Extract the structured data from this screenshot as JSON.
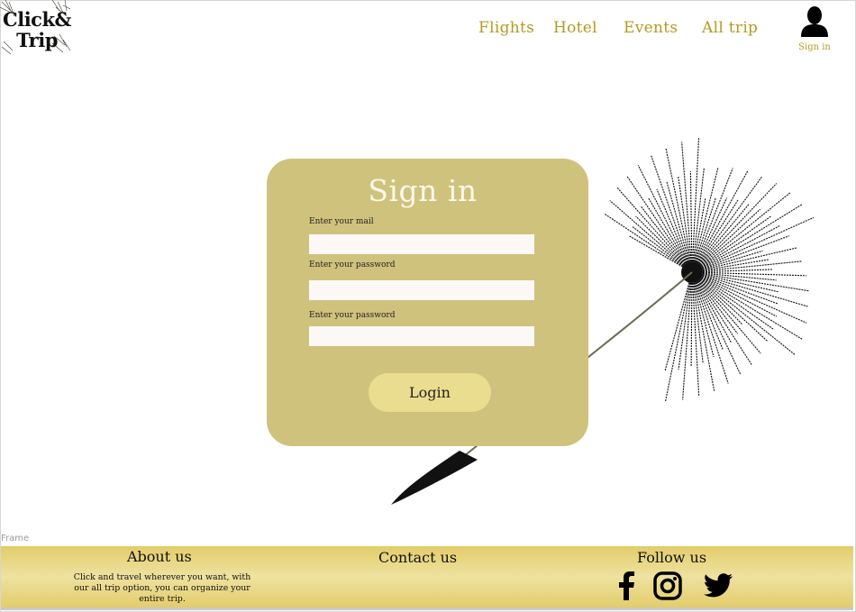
{
  "logo": {
    "text": "Click&\nTrip"
  },
  "nav": {
    "items": [
      {
        "label": "Flights"
      },
      {
        "label": "Hotel"
      },
      {
        "label": "Events"
      },
      {
        "label": "All trip"
      }
    ],
    "user_label": "Sign in"
  },
  "login": {
    "title": "Sign in",
    "fields": [
      {
        "label": "Enter your mail",
        "value": ""
      },
      {
        "label": "Enter your password",
        "value": ""
      },
      {
        "label": "Enter your password",
        "value": ""
      }
    ],
    "button_label": "Login"
  },
  "frame_label": "Frame",
  "footer": {
    "about_title": "About us",
    "about_text": "Click and travel wherever you want, with our all trip option, you can organize your entire trip.",
    "contact_title": "Contact us",
    "follow_title": "Follow us",
    "social_icons": [
      "facebook-icon",
      "instagram-icon",
      "twitter-icon"
    ]
  },
  "colors": {
    "accent": "#b39a1f",
    "card": "#cfc27d",
    "button": "#ebdd8f",
    "footer": "#e8d582"
  }
}
